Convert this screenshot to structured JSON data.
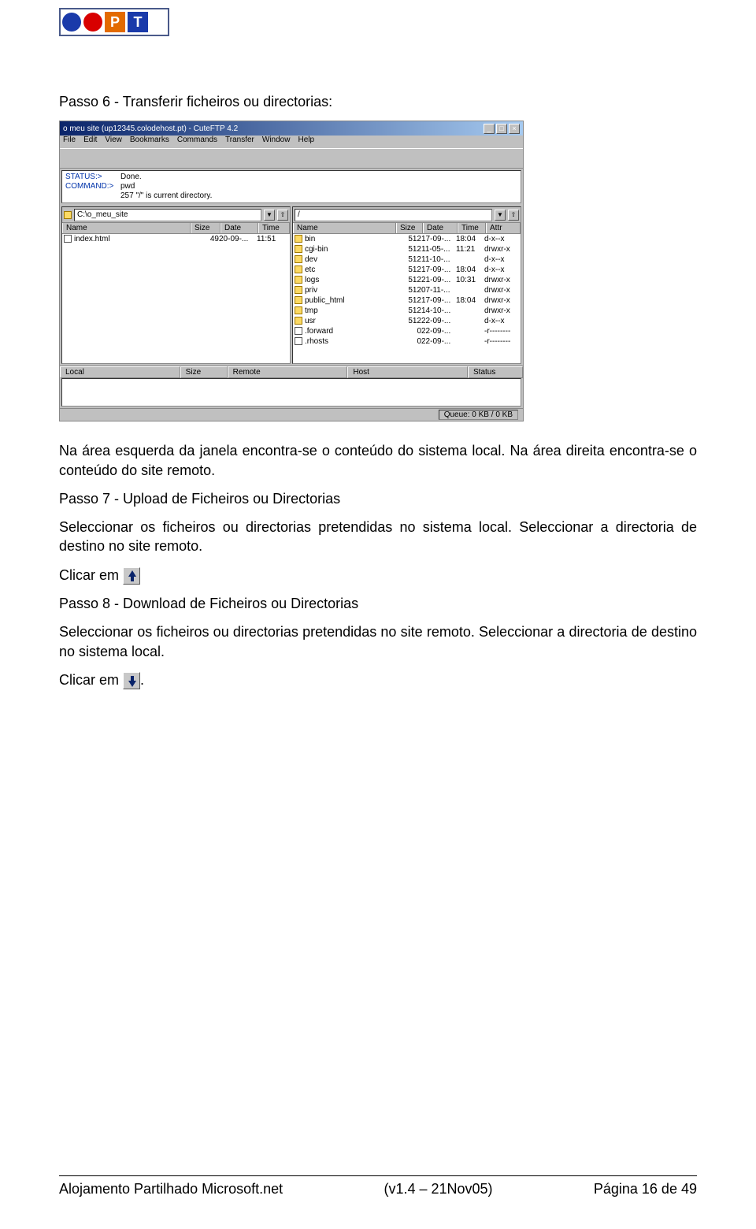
{
  "logo": {
    "p": "P",
    "t": "T"
  },
  "headings": {
    "h1": "Passo 6 - Transferir ficheiros ou directorias:",
    "p1": "Na área esquerda da janela encontra-se o conteúdo do sistema local. Na área direita encontra-se o conteúdo do site remoto.",
    "h2": "Passo 7 - Upload de Ficheiros ou Directorias",
    "p2": "Seleccionar os ficheiros ou directorias pretendidas no sistema local. Seleccionar a directoria de destino no site remoto.",
    "c1": "Clicar em",
    "h3": "Passo 8 - Download de Ficheiros ou Directorias",
    "p3": "Seleccionar os ficheiros ou directorias pretendidas no site remoto. Seleccionar a directoria de destino no sistema local.",
    "c2": "Clicar em",
    "dot": "."
  },
  "app": {
    "title": "o meu site (up12345.colodehost.pt) - CuteFTP 4.2",
    "menus": [
      "File",
      "Edit",
      "View",
      "Bookmarks",
      "Commands",
      "Transfer",
      "Window",
      "Help"
    ],
    "status": {
      "l1": "STATUS:>",
      "v1": "Done.",
      "l2": "COMMAND:>",
      "v2": "pwd",
      "v3": "257 \"/\" is current directory."
    },
    "leftPath": "C:\\o_meu_site",
    "rightPath": "/",
    "cols_local": [
      "Name",
      "Size",
      "Date",
      "Time"
    ],
    "cols_remote": [
      "Name",
      "Size",
      "Date",
      "Time",
      "Attr"
    ],
    "local_rows": [
      {
        "name": "index.html",
        "size": "49",
        "date": "20-09-...",
        "time": "11:51"
      }
    ],
    "remote_rows": [
      {
        "name": "bin",
        "size": "512",
        "date": "17-09-...",
        "time": "18:04",
        "attr": "d-x--x"
      },
      {
        "name": "cgi-bin",
        "size": "512",
        "date": "11-05-...",
        "time": "11:21",
        "attr": "drwxr-x"
      },
      {
        "name": "dev",
        "size": "512",
        "date": "11-10-...",
        "time": "",
        "attr": "d-x--x"
      },
      {
        "name": "etc",
        "size": "512",
        "date": "17-09-...",
        "time": "18:04",
        "attr": "d-x--x"
      },
      {
        "name": "logs",
        "size": "512",
        "date": "21-09-...",
        "time": "10:31",
        "attr": "drwxr-x"
      },
      {
        "name": "priv",
        "size": "512",
        "date": "07-11-...",
        "time": "",
        "attr": "drwxr-x"
      },
      {
        "name": "public_html",
        "size": "512",
        "date": "17-09-...",
        "time": "18:04",
        "attr": "drwxr-x"
      },
      {
        "name": "tmp",
        "size": "512",
        "date": "14-10-...",
        "time": "",
        "attr": "drwxr-x"
      },
      {
        "name": "usr",
        "size": "512",
        "date": "22-09-...",
        "time": "",
        "attr": "d-x--x"
      },
      {
        "name": ".forward",
        "size": "0",
        "date": "22-09-...",
        "time": "",
        "attr": "-r--------",
        "file": true
      },
      {
        "name": ".rhosts",
        "size": "0",
        "date": "22-09-...",
        "time": "",
        "attr": "-r--------",
        "file": true
      }
    ],
    "queue_cols": [
      "Local",
      "Size",
      "Remote",
      "Host",
      "Status"
    ],
    "queue_status": "Queue: 0 KB / 0 KB"
  },
  "footer": {
    "left": "Alojamento Partilhado Microsoft.net",
    "center": "(v1.4 – 21Nov05)",
    "right": "Página 16 de 49"
  }
}
